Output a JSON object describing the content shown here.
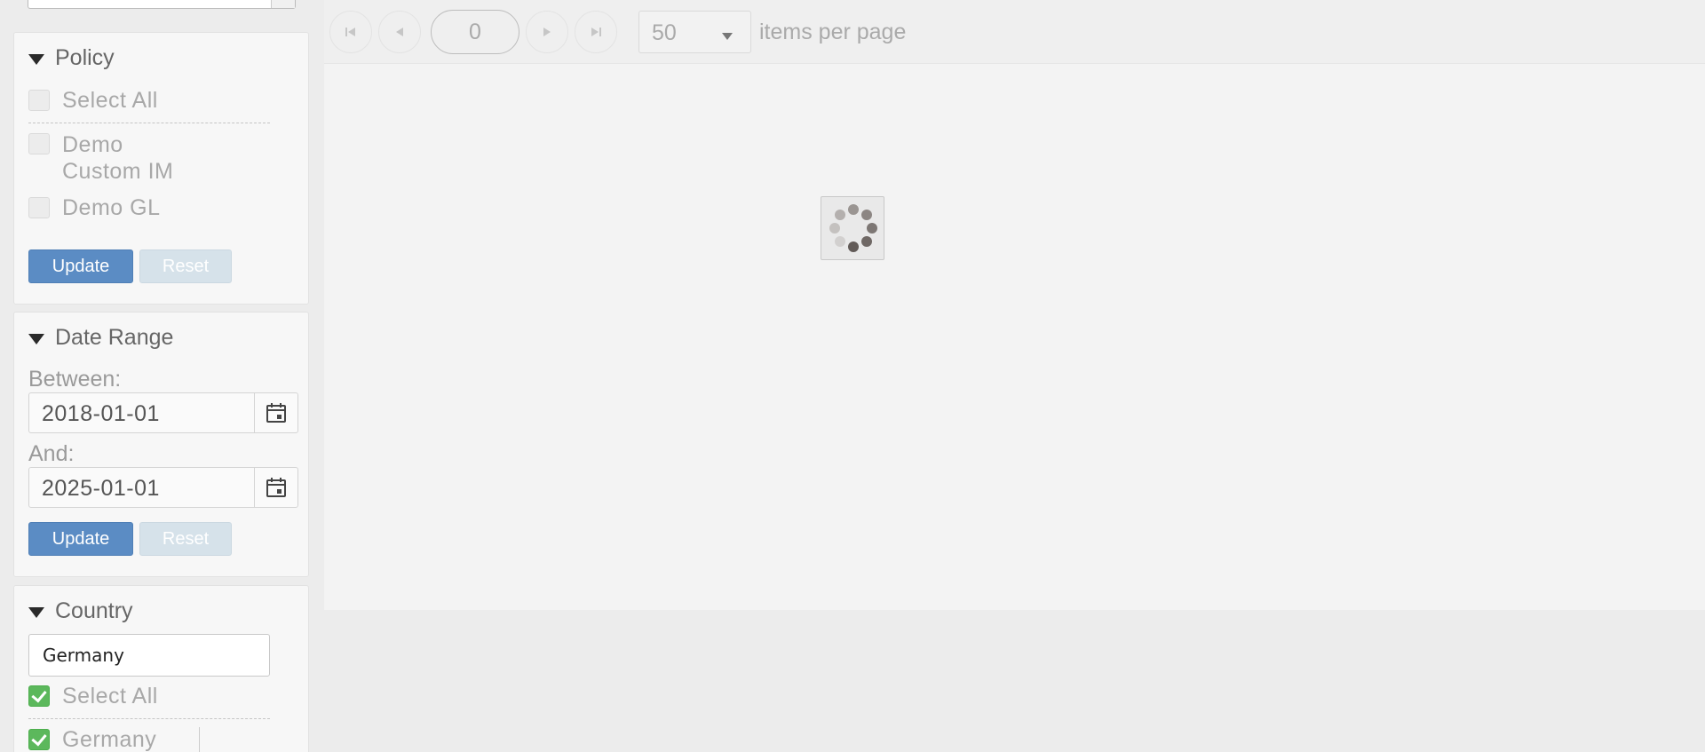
{
  "policy_panel": {
    "title": "Policy",
    "options": [
      {
        "label": "Select All",
        "checked": false
      },
      {
        "label": "Demo Custom IM",
        "checked": false
      },
      {
        "label": "Demo GL",
        "checked": false
      }
    ],
    "update_label": "Update",
    "reset_label": "Reset"
  },
  "date_range_panel": {
    "title": "Date Range",
    "between_label": "Between:",
    "between_value": "2018-01-01",
    "and_label": "And:",
    "and_value": "2025-01-01",
    "update_label": "Update",
    "reset_label": "Reset"
  },
  "country_panel": {
    "title": "Country",
    "filter_value": "Germany",
    "options": [
      {
        "label": "Select All",
        "checked": true
      },
      {
        "label": "Germany",
        "checked": true
      }
    ]
  },
  "pager": {
    "current_page": "0",
    "per_page_value": "50",
    "per_page_label": "items per page",
    "icons": [
      "first-page-icon",
      "previous-page-icon",
      "next-page-icon",
      "last-page-icon"
    ]
  },
  "loading": {
    "icon": "loading-spinner-icon"
  },
  "colors": {
    "primary_button": "#5b8cc4",
    "check_green": "#5cb85c",
    "panel_bg": "#f7f7f7"
  }
}
